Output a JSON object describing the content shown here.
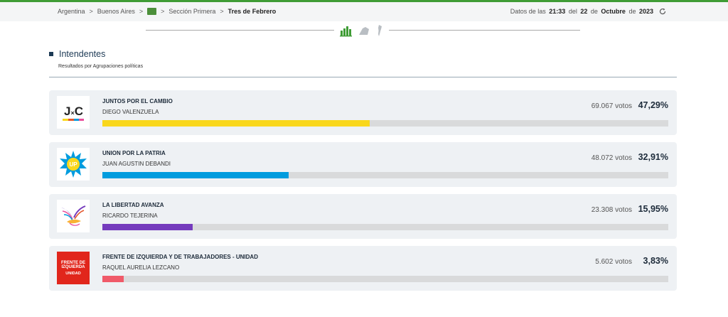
{
  "breadcrumb": {
    "items": [
      "Argentina",
      "Buenos Aires",
      "Sección Primera",
      "Tres de Febrero"
    ],
    "separator": ">"
  },
  "datetime": {
    "prefix": "Datos de las",
    "time": "21:33",
    "mid": "del",
    "day": "22",
    "of1": "de",
    "month": "Octubre",
    "of2": "de",
    "year": "2023"
  },
  "section": {
    "title": "Intendentes",
    "subtitle": "Resultados por Agrupaciones políticas"
  },
  "results": [
    {
      "party": "JUNTOS POR EL CAMBIO",
      "candidate": "DIEGO VALENZUELA",
      "votes": "69.067 votos",
      "percent": "47,29%",
      "share": 0.4729,
      "color": "#f9d71c",
      "logo": "jxc-logo"
    },
    {
      "party": "UNION POR LA PATRIA",
      "candidate": "JUAN AGUSTIN DEBANDI",
      "votes": "48.072 votos",
      "percent": "32,91%",
      "share": 0.3291,
      "color": "#009cde",
      "logo": "up-sun-logo"
    },
    {
      "party": "LA LIBERTAD AVANZA",
      "candidate": "RICARDO TEJERINA",
      "votes": "23.308 votos",
      "percent": "15,95%",
      "share": 0.1595,
      "color": "#753bbd",
      "logo": "lla-dove-logo"
    },
    {
      "party": "FRENTE DE IZQUIERDA Y DE TRABAJADORES - UNIDAD",
      "candidate": "RAQUEL AURELIA LEZCANO",
      "votes": "5.602 votos",
      "percent": "3,83%",
      "share": 0.0383,
      "color": "#f05a69",
      "logo": "fit-logo"
    }
  ],
  "logos": {
    "jxc": {
      "j": "J",
      "x": "×",
      "c": "C"
    },
    "up": "UP",
    "fit": [
      "FRENTE DE",
      "IZQUIERDA",
      "UNIDAD"
    ]
  },
  "icons": [
    "flag-icon",
    "refresh-icon",
    "bar-chart-icon",
    "map-icon",
    "argentina-map-icon"
  ]
}
